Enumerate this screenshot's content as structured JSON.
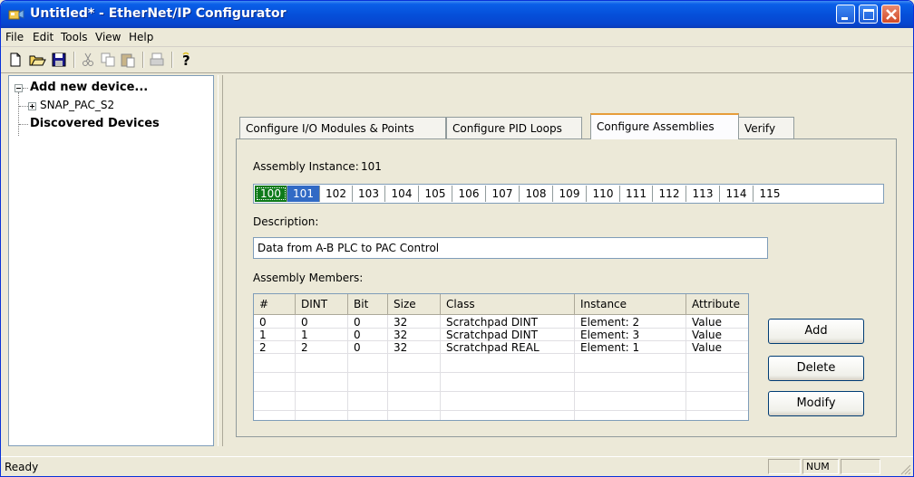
{
  "window": {
    "title": "Untitled* - EtherNet/IP Configurator"
  },
  "menu": [
    "File",
    "Edit",
    "Tools",
    "View",
    "Help"
  ],
  "tree": {
    "root": "Add new device...",
    "child": "SNAP_PAC_S2",
    "discovered": "Discovered Devices"
  },
  "tabs": [
    {
      "label": "Configure I/O Modules & Points"
    },
    {
      "label": "Configure PID Loops"
    },
    {
      "label": "Configure Assemblies"
    },
    {
      "label": "Verify"
    }
  ],
  "assembly": {
    "instance_label": "Assembly Instance:",
    "instance_value": "101",
    "instances": [
      "100",
      "101",
      "102",
      "103",
      "104",
      "105",
      "106",
      "107",
      "108",
      "109",
      "110",
      "111",
      "112",
      "113",
      "114",
      "115"
    ],
    "description_label": "Description:",
    "description_value": "Data from A-B PLC to PAC Control",
    "members_label": "Assembly Members:"
  },
  "members_table": {
    "headers": [
      "#",
      "DINT",
      "Bit",
      "Size",
      "Class",
      "Instance",
      "Attribute"
    ],
    "rows": [
      [
        "0",
        "0",
        "0",
        "32",
        "Scratchpad DINT",
        "Element: 2",
        "Value"
      ],
      [
        "1",
        "1",
        "0",
        "32",
        "Scratchpad DINT",
        "Element: 3",
        "Value"
      ],
      [
        "2",
        "2",
        "0",
        "32",
        "Scratchpad REAL",
        "Element: 1",
        "Value"
      ]
    ]
  },
  "buttons": {
    "add": "Add",
    "delete": "Delete",
    "modify": "Modify"
  },
  "status": {
    "text": "Ready",
    "num": "NUM"
  }
}
